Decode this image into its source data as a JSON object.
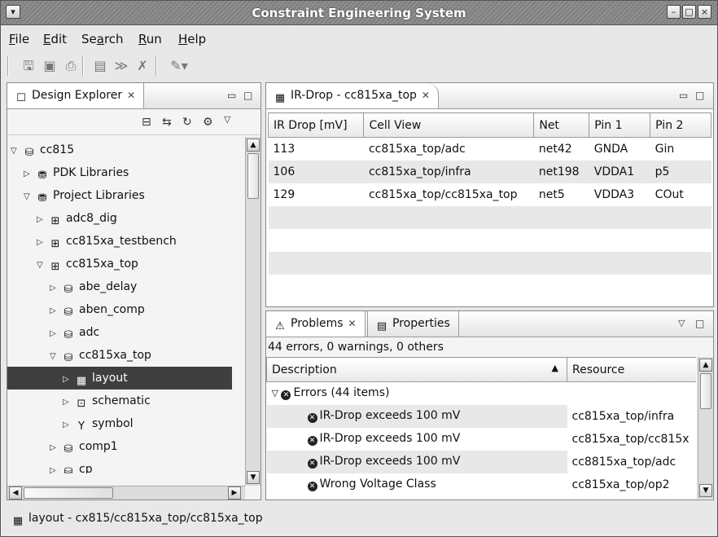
{
  "window": {
    "title": "Constraint Engineering System",
    "controls": [
      "minimize-icon",
      "maximize-icon",
      "close-icon"
    ]
  },
  "menu": {
    "items": [
      "File",
      "Edit",
      "Search",
      "Run",
      "Help"
    ],
    "mnemonics": [
      "F",
      "E",
      "a",
      "R",
      "H"
    ]
  },
  "toolbar": {
    "icons": [
      "save-icon",
      "save-all-icon",
      "print-icon",
      "new-constraint-icon",
      "check-icon",
      "delete-constraint-icon",
      "wand-icon"
    ]
  },
  "explorer": {
    "tab_label": "Design Explorer",
    "tree": [
      {
        "label": "cc815",
        "expanded": true,
        "icon": "project-icon"
      },
      {
        "label": "PDK Libraries",
        "expanded": false,
        "icon": "library-icon"
      },
      {
        "label": "Project Libraries",
        "expanded": true,
        "icon": "library-icon"
      },
      {
        "label": "adc8_dig",
        "expanded": false,
        "icon": "grid-library-icon"
      },
      {
        "label": "cc815xa_testbench",
        "expanded": false,
        "icon": "grid-library-icon"
      },
      {
        "label": "cc815xa_top",
        "expanded": true,
        "icon": "grid-library-icon"
      },
      {
        "label": "abe_delay",
        "expanded": false,
        "icon": "cell-icon"
      },
      {
        "label": "aben_comp",
        "expanded": false,
        "icon": "cell-icon"
      },
      {
        "label": "adc",
        "expanded": false,
        "icon": "cell-icon"
      },
      {
        "label": "cc815xa_top",
        "expanded": true,
        "icon": "cell-icon"
      },
      {
        "label": "layout",
        "expanded": false,
        "icon": "layout-view-icon",
        "selected": true
      },
      {
        "label": "schematic",
        "expanded": false,
        "icon": "schematic-view-icon"
      },
      {
        "label": "symbol",
        "expanded": false,
        "icon": "symbol-view-icon"
      },
      {
        "label": "comp1",
        "expanded": false,
        "icon": "cell-icon"
      },
      {
        "label": "cp",
        "expanded": false,
        "icon": "cell-icon"
      }
    ]
  },
  "irdrop": {
    "tab_label": "IR-Drop - cc815xa_top",
    "columns": [
      "IR Drop [mV]",
      "Cell View",
      "Net",
      "Pin 1",
      "Pin 2"
    ],
    "rows": [
      [
        "113",
        "cc815xa_top/adc",
        "net42",
        "GNDA",
        "Gin"
      ],
      [
        "106",
        "cc815xa_top/infra",
        "net198",
        "VDDA1",
        "p5"
      ],
      [
        "129",
        "cc815xa_top/cc815xa_top",
        "net5",
        "VDDA3",
        "COut"
      ]
    ]
  },
  "problems": {
    "tab_label": "Problems",
    "properties_tab_label": "Properties",
    "summary": "44 errors, 0 warnings, 0 others",
    "columns": [
      "Description",
      "Resource"
    ],
    "group_label": "Errors (44 items)",
    "rows": [
      {
        "description": "IR-Drop exceeds 100 mV",
        "resource": "cc815xa_top/infra"
      },
      {
        "description": "IR-Drop exceeds 100 mV",
        "resource": "cc815xa_top/cc815x"
      },
      {
        "description": "IR-Drop exceeds 100 mV",
        "resource": "cc8815xa_top/adc"
      },
      {
        "description": "Wrong Voltage Class",
        "resource": "cc815xa_top/op2"
      }
    ]
  },
  "status": {
    "text": "layout - cx815/cc815xa_top/cc815xa_top"
  }
}
